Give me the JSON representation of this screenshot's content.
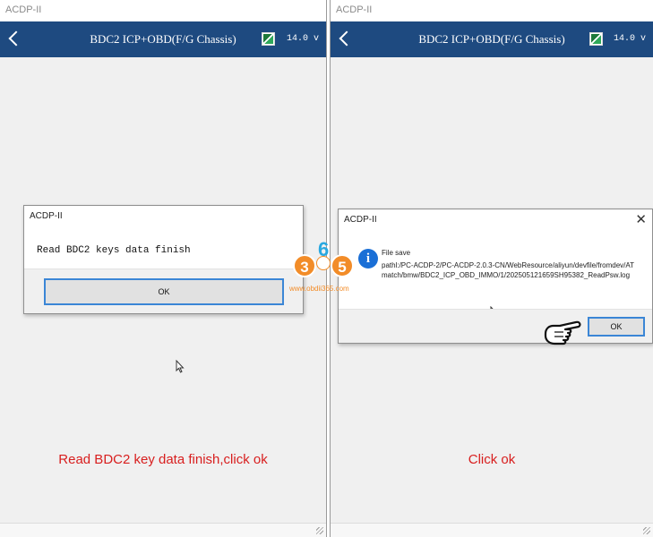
{
  "window": {
    "title": "ACDP-II"
  },
  "header": {
    "title": "BDC2 ICP+OBD(F/G Chassis)",
    "voltage": "14.0 v"
  },
  "left": {
    "dialog": {
      "title": "ACDP-II",
      "message": "Read BDC2 keys data finish",
      "ok_label": "OK"
    },
    "caption": "Read BDC2 key data finish,click ok"
  },
  "right": {
    "dialog": {
      "title": "ACDP-II",
      "close_label": "✕",
      "label": "File save",
      "path": "pathl:/PC-ACDP-2/PC-ACDP-2.0.3-CN/WebResource/aliyun/devfile/fromdev/ATmatch/bmw/BDC2_ICP_OBD_IMMO/1/202505121659SH95382_ReadPsw.log",
      "ok_label": "OK"
    },
    "caption": "Click ok"
  },
  "watermark": {
    "digit_left": "3",
    "digit_mid": "6",
    "digit_right": "5",
    "site": "www.obdii365.com"
  },
  "icons": {
    "back": "chevron-left-icon",
    "battery": "battery-icon",
    "info": "info-icon",
    "cursor": "mouse-cursor-icon",
    "hand": "pointing-hand-icon",
    "grip": "resize-grip-icon"
  },
  "colors": {
    "header_bg": "#1e4a80",
    "caption": "#d81e1e",
    "button_border": "#3b86d6",
    "info": "#1a6fd6",
    "watermark": "#f28c28"
  }
}
